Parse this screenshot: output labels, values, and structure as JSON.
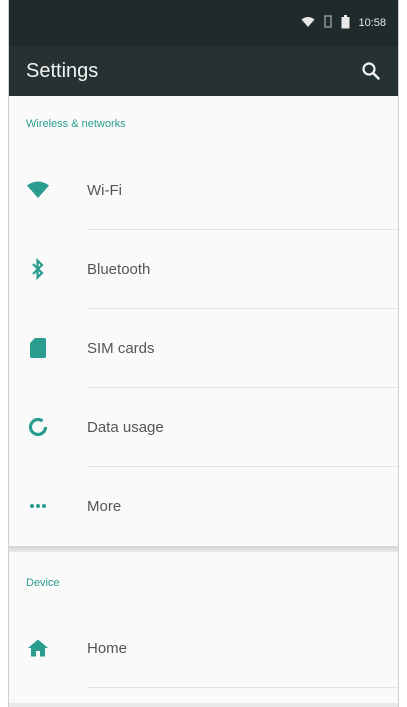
{
  "status_bar": {
    "time": "10:58",
    "icons": [
      "wifi-icon",
      "signal-icon",
      "battery-icon"
    ]
  },
  "app_bar": {
    "title": "Settings",
    "search_icon": "search-icon"
  },
  "colors": {
    "accent": "#2a9d8f",
    "appbar": "#263232",
    "statusbar": "#1f2a2a"
  },
  "sections": [
    {
      "header": "Wireless & networks",
      "items": [
        {
          "label": "Wi-Fi",
          "icon": "wifi-icon"
        },
        {
          "label": "Bluetooth",
          "icon": "bluetooth-icon"
        },
        {
          "label": "SIM cards",
          "icon": "sim-card-icon"
        },
        {
          "label": "Data usage",
          "icon": "data-usage-icon"
        },
        {
          "label": "More",
          "icon": "more-icon"
        }
      ]
    },
    {
      "header": "Device",
      "items": [
        {
          "label": "Home",
          "icon": "home-icon"
        }
      ]
    }
  ]
}
